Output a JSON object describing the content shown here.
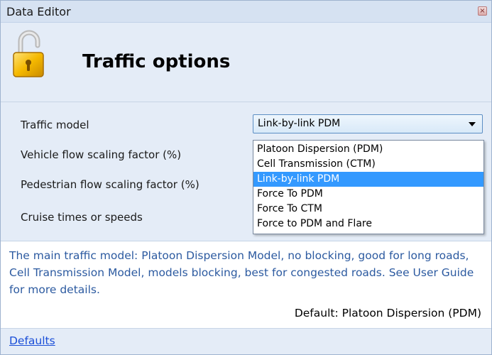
{
  "window": {
    "title": "Data Editor",
    "close_glyph": "×"
  },
  "header": {
    "title": "Traffic options",
    "icon": "padlock-unlocked-icon"
  },
  "fields": {
    "traffic_model_label": "Traffic model",
    "vehicle_scaling_label": "Vehicle flow scaling factor (%)",
    "pedestrian_scaling_label": "Pedestrian flow scaling factor (%)",
    "cruise_label": "Cruise times or speeds"
  },
  "traffic_model": {
    "selected": "Link-by-link PDM",
    "options": [
      "Platoon Dispersion (PDM)",
      "Cell Transmission (CTM)",
      "Link-by-link PDM",
      "Force To PDM",
      "Force To CTM",
      "Force to PDM and Flare"
    ],
    "selected_index": 2
  },
  "info": {
    "description": "The main traffic model: Platoon Dispersion Model, no blocking, good for long roads, Cell Transmission Model, models blocking, best for congested roads. See User Guide for more details.",
    "default": "Default: Platoon Dispersion (PDM)"
  },
  "footer": {
    "defaults_link": "Defaults"
  },
  "colors": {
    "window_bg": "#e4ecf7",
    "selection": "#3399ff",
    "info_text": "#2c5aa0",
    "link": "#1a4ed8"
  }
}
